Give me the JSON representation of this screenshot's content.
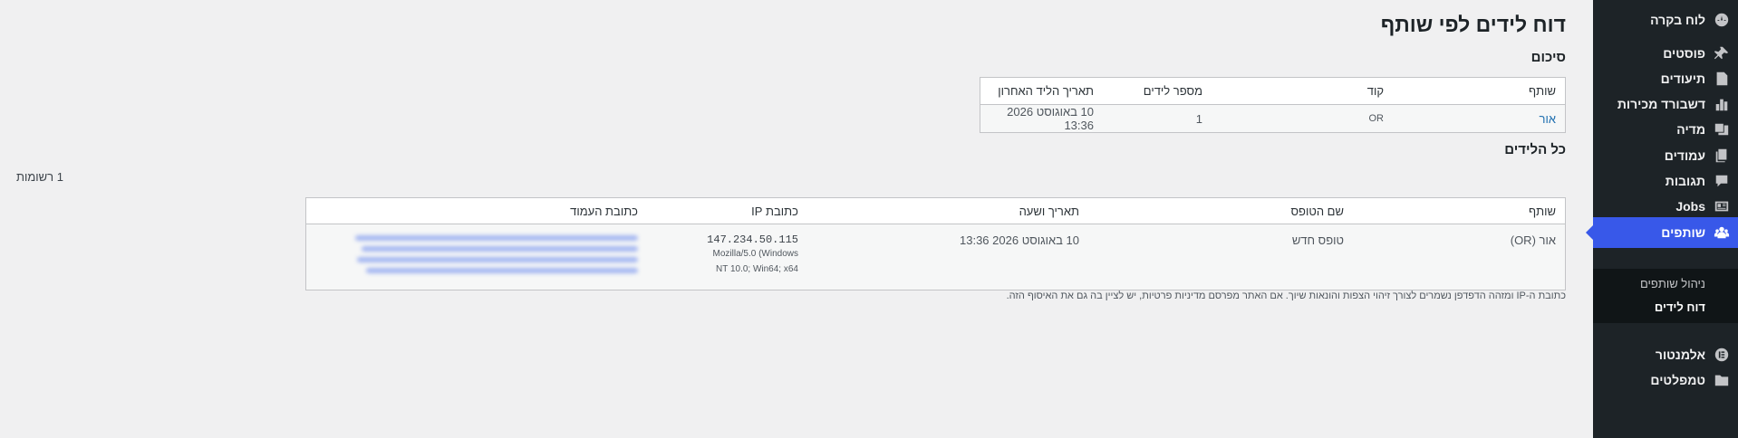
{
  "sidebar": {
    "items": [
      {
        "label": "לוח בקרה",
        "icon": "dashboard-icon"
      },
      {
        "label": "פוסטים",
        "icon": "pin-icon"
      },
      {
        "label": "תיעודים",
        "icon": "document-icon"
      },
      {
        "label": "דשבורד מכירות",
        "icon": "bar-chart-icon"
      },
      {
        "label": "מדיה",
        "icon": "media-icon"
      },
      {
        "label": "עמודים",
        "icon": "pages-icon"
      },
      {
        "label": "תגובות",
        "icon": "comment-icon"
      },
      {
        "label": "Jobs",
        "icon": "id-card-icon"
      },
      {
        "label": "שותפים",
        "icon": "groups-icon",
        "active": true
      },
      {
        "label": "אלמנטור",
        "icon": "elementor-icon"
      },
      {
        "label": "טמפלטים",
        "icon": "folder-icon"
      }
    ],
    "submenu": [
      {
        "label": "ניהול שותפים"
      },
      {
        "label": "דוח לידים",
        "current": true
      }
    ],
    "active_color": "#3858e9"
  },
  "page": {
    "title": "דוח לידים לפי שותף",
    "summary_title": "סיכום",
    "leads_title": "כל הלידים",
    "records_count": "1 רשומות",
    "footnote": "כתובת ה-IP ומזהה הדפדפן נשמרים לצורך זיהוי הצפות והונאות שיוך. אם האתר מפרסם מדיניות פרטיות, יש לציין בה גם את האיסוף הזה."
  },
  "summary_table": {
    "headers": [
      "שותף",
      "קוד",
      "מספר לידים",
      "תאריך הליד האחרון"
    ],
    "rows": [
      {
        "partner": "אור",
        "code": "OR",
        "leads": "1",
        "last_date": "10 באוגוסט 2026 13:36"
      }
    ]
  },
  "leads_table": {
    "headers": [
      "שותף",
      "שם הטופס",
      "תאריך ושעה",
      "כתובת IP",
      "כתובת העמוד"
    ],
    "rows": [
      {
        "partner": "אור (OR)",
        "form": "טופס חדש",
        "datetime": "10 באוגוסט 2026 13:36",
        "ip": "147.234.50.115",
        "user_agent": "Mozilla/5.0 (Windows NT 10.0; Win64; x64",
        "page_url": ""
      }
    ]
  }
}
